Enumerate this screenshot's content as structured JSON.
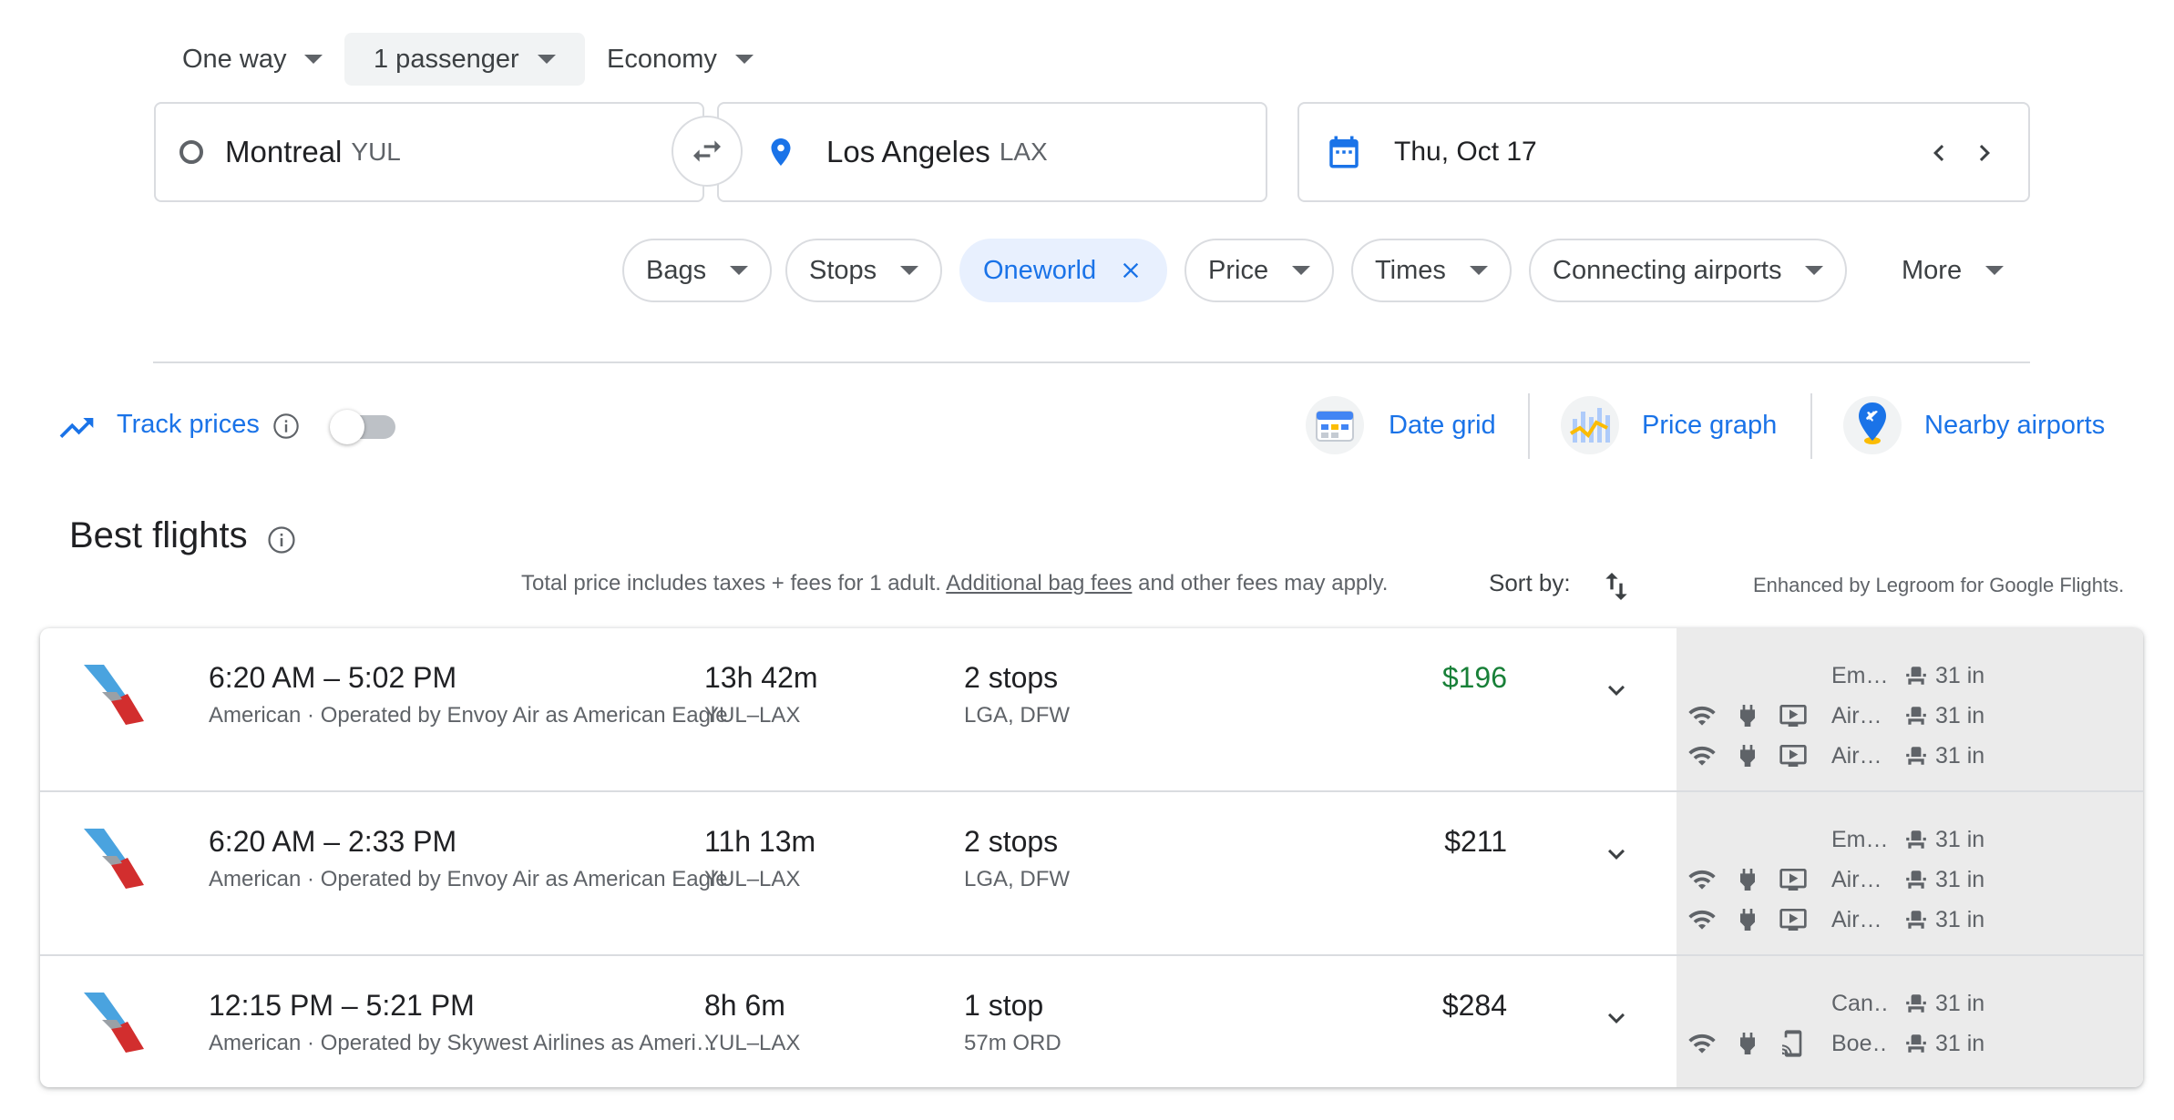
{
  "search": {
    "trip_type": "One way",
    "passengers": "1 passenger",
    "cabin": "Economy",
    "origin": {
      "city": "Montreal",
      "code": "YUL"
    },
    "destination": {
      "city": "Los Angeles",
      "code": "LAX"
    },
    "date": "Thu, Oct 17"
  },
  "filters": [
    "Bags",
    "Stops",
    "Oneworld",
    "Price",
    "Times",
    "Connecting airports",
    "More"
  ],
  "tools": {
    "track_prices": "Track prices",
    "track_prices_on": false,
    "date_grid": "Date grid",
    "price_graph": "Price graph",
    "nearby_airports": "Nearby airports"
  },
  "results": {
    "title": "Best flights",
    "info_prefix": "Total price includes taxes + fees for 1 adult.",
    "info_link": "Additional bag fees",
    "info_suffix": "and other fees may apply.",
    "sort_label": "Sort by:",
    "enhanced_by": "Enhanced by Legroom for Google Flights."
  },
  "flights": [
    {
      "times": "6:20 AM – 5:02 PM",
      "airline": "American · Operated by Envoy Air as American Eagle",
      "duration": "13h 42m",
      "route": "YUL–LAX",
      "stops": "2 stops",
      "stop_detail": "LGA, DFW",
      "price": "$196",
      "price_color": "#188038",
      "legroom": [
        {
          "aircraft": "Em…",
          "amenities": [],
          "seat": "31 in"
        },
        {
          "aircraft": "Air…",
          "amenities": [
            "wifi-icon",
            "power-icon",
            "video-icon"
          ],
          "seat": "31 in"
        },
        {
          "aircraft": "Air…",
          "amenities": [
            "wifi-icon",
            "power-icon",
            "video-icon"
          ],
          "seat": "31 in"
        }
      ]
    },
    {
      "times": "6:20 AM – 2:33 PM",
      "airline": "American · Operated by Envoy Air as American Eagle",
      "duration": "11h 13m",
      "route": "YUL–LAX",
      "stops": "2 stops",
      "stop_detail": "LGA, DFW",
      "price": "$211",
      "price_color": "#202124",
      "legroom": [
        {
          "aircraft": "Em…",
          "amenities": [],
          "seat": "31 in"
        },
        {
          "aircraft": "Air…",
          "amenities": [
            "wifi-icon",
            "power-icon",
            "video-icon"
          ],
          "seat": "31 in"
        },
        {
          "aircraft": "Air…",
          "amenities": [
            "wifi-icon",
            "power-icon",
            "video-icon"
          ],
          "seat": "31 in"
        }
      ]
    },
    {
      "times": "12:15 PM – 5:21 PM",
      "airline": "American · Operated by Skywest Airlines as American Eagle",
      "duration": "8h 6m",
      "route": "YUL–LAX",
      "stops": "1 stop",
      "stop_detail": "57m ORD",
      "price": "$284",
      "price_color": "#202124",
      "legroom": [
        {
          "aircraft": "Can…",
          "amenities": [],
          "seat": "31 in"
        },
        {
          "aircraft": "Boe…",
          "amenities": [
            "wifi-icon",
            "power-icon",
            "stream-icon"
          ],
          "seat": "31 in"
        }
      ]
    }
  ]
}
